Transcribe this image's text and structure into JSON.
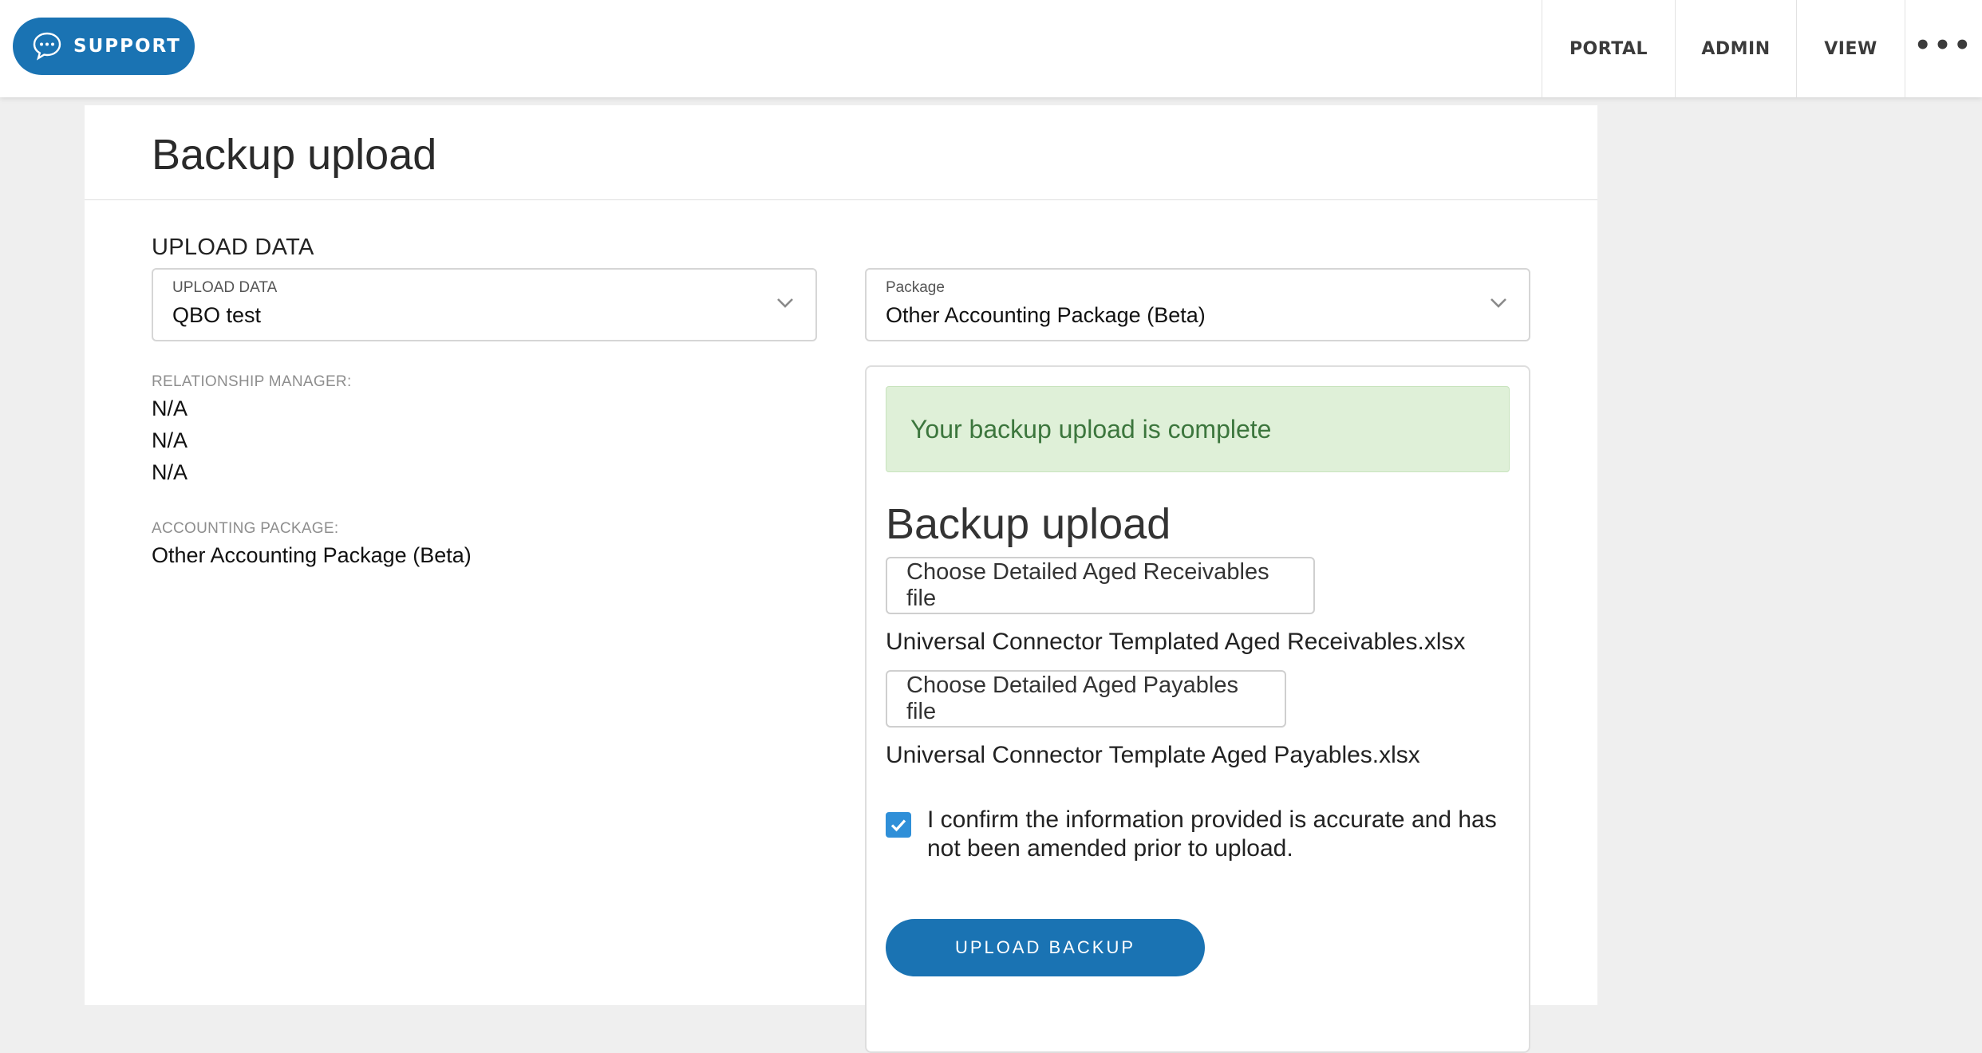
{
  "topbar": {
    "support_label": "SUPPORT",
    "nav": {
      "portal": "PORTAL",
      "admin": "ADMIN",
      "view": "VIEW",
      "more": "•••"
    }
  },
  "page": {
    "title": "Backup upload"
  },
  "upload_data": {
    "section_label": "UPLOAD DATA",
    "select_label": "UPLOAD DATA",
    "select_value": "QBO test"
  },
  "package": {
    "select_label": "Package",
    "select_value": "Other Accounting Package (Beta)"
  },
  "relationship_manager": {
    "label": "RELATIONSHIP MANAGER:",
    "values": [
      "N/A",
      "N/A",
      "N/A"
    ]
  },
  "accounting_package": {
    "label": "ACCOUNTING PACKAGE:",
    "value": "Other Accounting Package (Beta)"
  },
  "panel": {
    "success_message": "Your backup upload is complete",
    "title": "Backup upload",
    "receivables_button": "Choose Detailed Aged Receivables file",
    "receivables_file": "Universal Connector Templated Aged Receivables.xlsx",
    "payables_button": "Choose Detailed Aged Payables file",
    "payables_file": "Universal Connector Template Aged Payables.xlsx",
    "confirm_text": "I confirm the information provided is accurate and has not been amended prior to upload.",
    "confirm_checked": true,
    "upload_button": "UPLOAD BACKUP"
  },
  "colors": {
    "primary": "#1a73b3",
    "checkbox": "#2f8fd8",
    "success_bg": "#dff0d8",
    "success_text": "#3c763d"
  }
}
